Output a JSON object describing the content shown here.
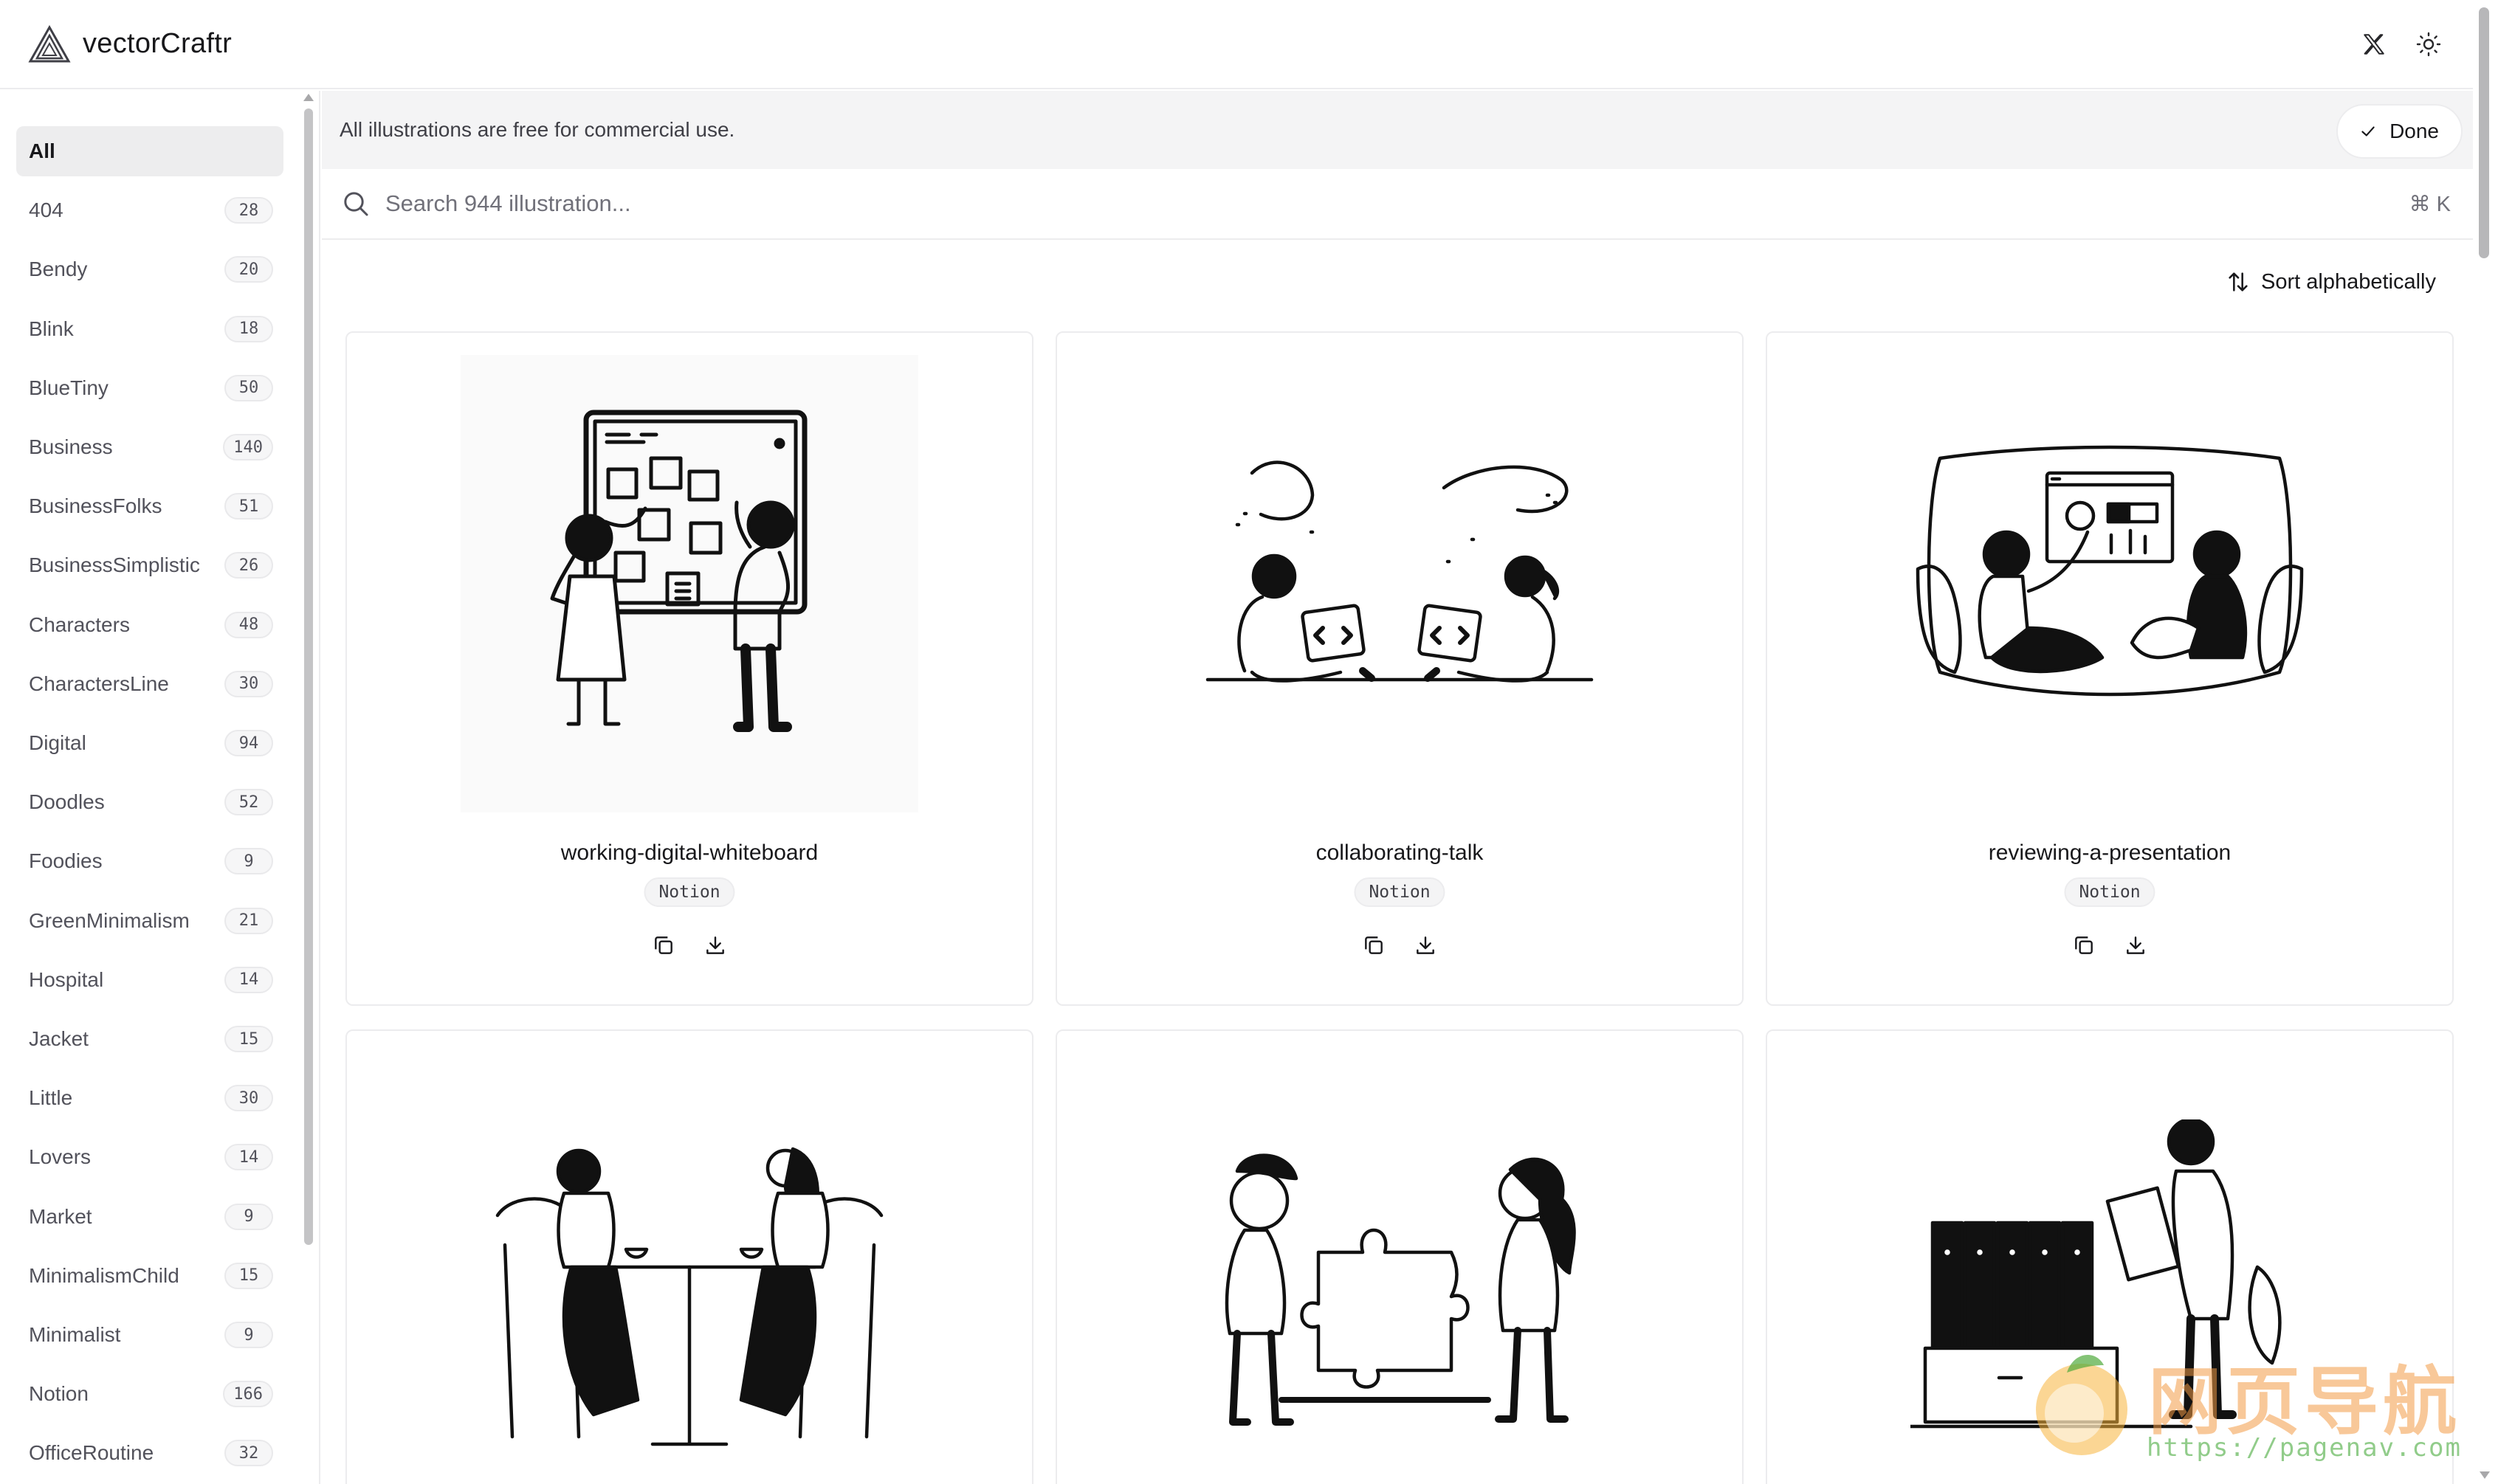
{
  "app": {
    "brand": "vectorCraftr"
  },
  "header": {
    "x_icon": "x-logo-icon",
    "theme_icon": "sun-icon"
  },
  "sidebar": {
    "items": [
      {
        "label": "All",
        "count": null,
        "active": true
      },
      {
        "label": "404",
        "count": "28"
      },
      {
        "label": "Bendy",
        "count": "20"
      },
      {
        "label": "Blink",
        "count": "18"
      },
      {
        "label": "BlueTiny",
        "count": "50"
      },
      {
        "label": "Business",
        "count": "140"
      },
      {
        "label": "BusinessFolks",
        "count": "51"
      },
      {
        "label": "BusinessSimplistic",
        "count": "26"
      },
      {
        "label": "Characters",
        "count": "48"
      },
      {
        "label": "CharactersLine",
        "count": "30"
      },
      {
        "label": "Digital",
        "count": "94"
      },
      {
        "label": "Doodles",
        "count": "52"
      },
      {
        "label": "Foodies",
        "count": "9"
      },
      {
        "label": "GreenMinimalism",
        "count": "21"
      },
      {
        "label": "Hospital",
        "count": "14"
      },
      {
        "label": "Jacket",
        "count": "15"
      },
      {
        "label": "Little",
        "count": "30"
      },
      {
        "label": "Lovers",
        "count": "14"
      },
      {
        "label": "Market",
        "count": "9"
      },
      {
        "label": "MinimalismChild",
        "count": "15"
      },
      {
        "label": "Minimalist",
        "count": "9"
      },
      {
        "label": "Notion",
        "count": "166"
      },
      {
        "label": "OfficeRoutine",
        "count": "32"
      }
    ]
  },
  "notice": {
    "text": "All illustrations are free for commercial use.",
    "done_label": "Done"
  },
  "search": {
    "placeholder": "Search 944 illustration...",
    "shortcut": "⌘ K"
  },
  "sort": {
    "label": "Sort alphabetically"
  },
  "cards": [
    {
      "title": "working-digital-whiteboard",
      "tag": "Notion"
    },
    {
      "title": "collaborating-talk",
      "tag": "Notion"
    },
    {
      "title": "reviewing-a-presentation",
      "tag": "Notion"
    },
    {
      "title": "",
      "tag": ""
    },
    {
      "title": "",
      "tag": ""
    },
    {
      "title": "",
      "tag": ""
    }
  ],
  "watermark": {
    "text": "网页导航",
    "url": "https://pagenav.com"
  }
}
